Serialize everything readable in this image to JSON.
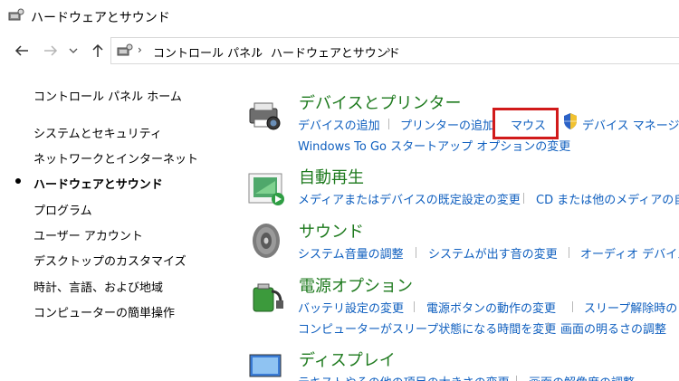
{
  "window": {
    "title": "ハードウェアとサウンド"
  },
  "address": {
    "crumbs": [
      "コントロール パネル",
      "ハードウェアとサウンド"
    ],
    "separator": "›"
  },
  "nav": {
    "back": "←",
    "forward": "→",
    "recent": "∨",
    "up": "↑"
  },
  "sidebar": {
    "items": [
      {
        "label": "コントロール パネル ホーム"
      },
      {
        "label": "システムとセキュリティ"
      },
      {
        "label": "ネットワークとインターネット"
      },
      {
        "label": "ハードウェアとサウンド",
        "active": true
      },
      {
        "label": "プログラム"
      },
      {
        "label": "ユーザー アカウント"
      },
      {
        "label": "デスクトップのカスタマイズ"
      },
      {
        "label": "時計、言語、および地域"
      },
      {
        "label": "コンピューターの簡単操作"
      }
    ]
  },
  "categories": {
    "devices": {
      "title": "デバイスとプリンター",
      "links": [
        "デバイスの追加",
        "プリンターの追加",
        "マウス",
        "デバイス マネージャー"
      ],
      "links2": [
        "Windows To Go スタートアップ オプションの変更"
      ]
    },
    "autoplay": {
      "title": "自動再生",
      "links": [
        "メディアまたはデバイスの既定設定の変更",
        "CD または他のメディアの自動"
      ]
    },
    "sound": {
      "title": "サウンド",
      "links": [
        "システム音量の調整",
        "システムが出す音の変更",
        "オーディオ デバイスの"
      ]
    },
    "power": {
      "title": "電源オプション",
      "links": [
        "バッテリ設定の変更",
        "電源ボタンの動作の変更",
        "スリープ解除時の"
      ],
      "links2": [
        "コンピューターがスリープ状態になる時間を変更",
        "画面の明るさの調整"
      ]
    },
    "display": {
      "title": "ディスプレイ",
      "links": [
        "テキストやその他の項目の大きさの変更",
        "画面の解像度の調整"
      ]
    }
  },
  "colors": {
    "link": "#0f5fbf",
    "category_title": "#1e7a1e",
    "highlight": "#d11a1a"
  }
}
